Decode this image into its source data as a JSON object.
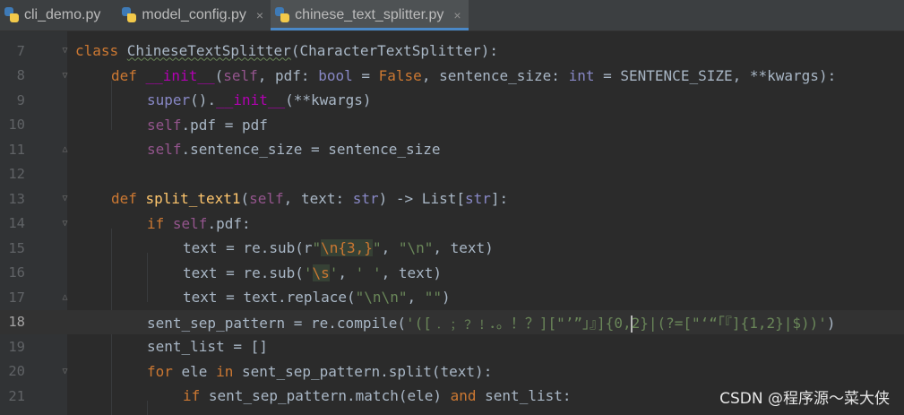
{
  "tabs": [
    {
      "label": "cli_demo.py",
      "active": false,
      "close": ""
    },
    {
      "label": "model_config.py",
      "active": false,
      "close": "×"
    },
    {
      "label": "chinese_text_splitter.py",
      "active": true,
      "close": "×"
    }
  ],
  "lines": [
    {
      "n": "7",
      "fold": "▽"
    },
    {
      "n": "8",
      "fold": "▽"
    },
    {
      "n": "9",
      "fold": ""
    },
    {
      "n": "10",
      "fold": ""
    },
    {
      "n": "11",
      "fold": "△"
    },
    {
      "n": "12",
      "fold": ""
    },
    {
      "n": "13",
      "fold": "▽"
    },
    {
      "n": "14",
      "fold": "▽"
    },
    {
      "n": "15",
      "fold": ""
    },
    {
      "n": "16",
      "fold": ""
    },
    {
      "n": "17",
      "fold": "△"
    },
    {
      "n": "18",
      "fold": ""
    },
    {
      "n": "19",
      "fold": ""
    },
    {
      "n": "20",
      "fold": "▽"
    },
    {
      "n": "21",
      "fold": ""
    }
  ],
  "code": {
    "l7": {
      "kw": "class ",
      "name": "ChineseTextSplitter",
      "rest": "(CharacterTextSplitter):"
    },
    "l8": {
      "def": "def ",
      "fn": "__init__",
      "p1": "(",
      "self": "self",
      "p2": ", pdf: ",
      "bool": "bool",
      "p3": " = ",
      "false": "False",
      "p4": ", sentence_size: ",
      "int": "int",
      "p5": " = SENTENCE_SIZE, **kwargs):"
    },
    "l9": {
      "super": "super",
      "p1": "().",
      "init": "__init__",
      "p2": "(**kwargs)"
    },
    "l10": {
      "self": "self",
      "rest": ".pdf = pdf"
    },
    "l11": {
      "self": "self",
      "rest": ".sentence_size = sentence_size"
    },
    "l13": {
      "def": "def ",
      "fn": "split_text1",
      "p1": "(",
      "self": "self",
      "p2": ", text: ",
      "str": "str",
      "p3": ") -> List[",
      "str2": "str",
      "p4": "]:"
    },
    "l14": {
      "if": "if ",
      "self": "self",
      "rest": ".pdf:"
    },
    "l15": {
      "a": "text = re.sub(r",
      "q1": "\"",
      "esc": "\\n{3,}",
      "q2": "\"",
      "c1": ", ",
      "s2": "\"\\n\"",
      "c2": ", text)"
    },
    "l16": {
      "a": "text = re.sub(",
      "q1": "'",
      "esc": "\\s",
      "q2": "'",
      "c1": ", ",
      "s2": "' '",
      "c2": ", text)"
    },
    "l17": {
      "a": "text = text.replace(",
      "s1": "\"\\n\\n\"",
      "c1": ", ",
      "s2": "\"\"",
      "c2": ")"
    },
    "l18": {
      "a": "sent_sep_pattern = re.compile(",
      "s1": "'([﹒﹔﹖﹗．。！？][\"’”」』]{0,",
      "s2": "2}|(?=[\"‘“「『]{1,2}|$))'",
      "c": ")"
    },
    "l19": {
      "rest": "sent_list = []"
    },
    "l20": {
      "for": "for ",
      "a": "ele ",
      "in": "in ",
      "rest": "sent_sep_pattern.split(text):"
    },
    "l21": {
      "if": "if ",
      "a": "sent_sep_pattern.match(ele) ",
      "and": "and ",
      "rest": "sent_list:"
    }
  },
  "watermark": "CSDN @程序源～菜大侠",
  "colors": {
    "bg": "#2b2b2b",
    "keyword": "#cc7832",
    "function": "#ffc66d",
    "self": "#94558d",
    "string": "#6a8759",
    "number": "#6897bb",
    "tab_underline": "#4a88c7"
  }
}
